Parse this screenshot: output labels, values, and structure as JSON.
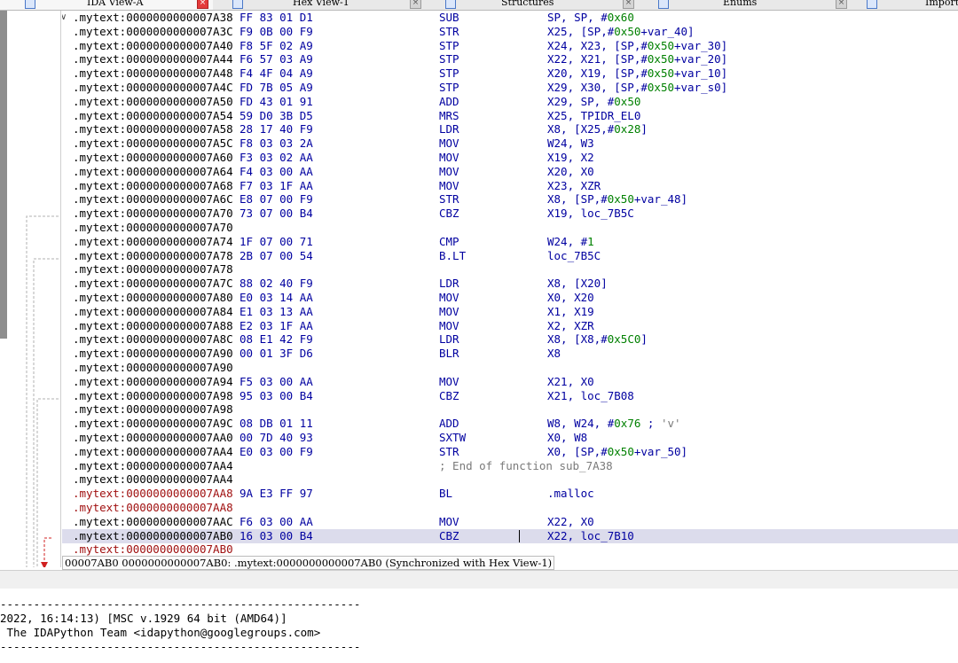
{
  "tabs": [
    {
      "label": "IDA View-A",
      "icon": "listing-icon",
      "close": "red"
    },
    {
      "label": "Hex View-1",
      "icon": "hex-icon",
      "close": "grey"
    },
    {
      "label": "Structures",
      "icon": "struct-icon",
      "close": "grey"
    },
    {
      "label": "Enums",
      "icon": "enum-icon",
      "close": "grey"
    },
    {
      "label": "Import",
      "icon": "import-icon",
      "close": ""
    }
  ],
  "listing": [
    {
      "addr": ".mytext:0000000000007A38",
      "bytes": "FF 83 01 D1",
      "mn": "SUB",
      "op": "SP, SP, #0x60",
      "fold": true
    },
    {
      "addr": ".mytext:0000000000007A3C",
      "bytes": "F9 0B 00 F9",
      "mn": "STR",
      "op": "X25, [SP,#0x50+var_40]"
    },
    {
      "addr": ".mytext:0000000000007A40",
      "bytes": "F8 5F 02 A9",
      "mn": "STP",
      "op": "X24, X23, [SP,#0x50+var_30]"
    },
    {
      "addr": ".mytext:0000000000007A44",
      "bytes": "F6 57 03 A9",
      "mn": "STP",
      "op": "X22, X21, [SP,#0x50+var_20]"
    },
    {
      "addr": ".mytext:0000000000007A48",
      "bytes": "F4 4F 04 A9",
      "mn": "STP",
      "op": "X20, X19, [SP,#0x50+var_10]"
    },
    {
      "addr": ".mytext:0000000000007A4C",
      "bytes": "FD 7B 05 A9",
      "mn": "STP",
      "op": "X29, X30, [SP,#0x50+var_s0]"
    },
    {
      "addr": ".mytext:0000000000007A50",
      "bytes": "FD 43 01 91",
      "mn": "ADD",
      "op": "X29, SP, #0x50"
    },
    {
      "addr": ".mytext:0000000000007A54",
      "bytes": "59 D0 3B D5",
      "mn": "MRS",
      "op": "X25, TPIDR_EL0"
    },
    {
      "addr": ".mytext:0000000000007A58",
      "bytes": "28 17 40 F9",
      "mn": "LDR",
      "op": "X8, [X25,#0x28]"
    },
    {
      "addr": ".mytext:0000000000007A5C",
      "bytes": "F8 03 03 2A",
      "mn": "MOV",
      "op": "W24, W3"
    },
    {
      "addr": ".mytext:0000000000007A60",
      "bytes": "F3 03 02 AA",
      "mn": "MOV",
      "op": "X19, X2"
    },
    {
      "addr": ".mytext:0000000000007A64",
      "bytes": "F4 03 00 AA",
      "mn": "MOV",
      "op": "X20, X0"
    },
    {
      "addr": ".mytext:0000000000007A68",
      "bytes": "F7 03 1F AA",
      "mn": "MOV",
      "op": "X23, XZR"
    },
    {
      "addr": ".mytext:0000000000007A6C",
      "bytes": "E8 07 00 F9",
      "mn": "STR",
      "op": "X8, [SP,#0x50+var_48]"
    },
    {
      "addr": ".mytext:0000000000007A70",
      "bytes": "73 07 00 B4",
      "mn": "CBZ",
      "op": "X19, loc_7B5C"
    },
    {
      "addr": ".mytext:0000000000007A70",
      "bytes": "",
      "mn": "",
      "op": ""
    },
    {
      "addr": ".mytext:0000000000007A74",
      "bytes": "1F 07 00 71",
      "mn": "CMP",
      "op": "W24, #1"
    },
    {
      "addr": ".mytext:0000000000007A78",
      "bytes": "2B 07 00 54",
      "mn": "B.LT",
      "op": "loc_7B5C"
    },
    {
      "addr": ".mytext:0000000000007A78",
      "bytes": "",
      "mn": "",
      "op": ""
    },
    {
      "addr": ".mytext:0000000000007A7C",
      "bytes": "88 02 40 F9",
      "mn": "LDR",
      "op": "X8, [X20]"
    },
    {
      "addr": ".mytext:0000000000007A80",
      "bytes": "E0 03 14 AA",
      "mn": "MOV",
      "op": "X0, X20"
    },
    {
      "addr": ".mytext:0000000000007A84",
      "bytes": "E1 03 13 AA",
      "mn": "MOV",
      "op": "X1, X19"
    },
    {
      "addr": ".mytext:0000000000007A88",
      "bytes": "E2 03 1F AA",
      "mn": "MOV",
      "op": "X2, XZR"
    },
    {
      "addr": ".mytext:0000000000007A8C",
      "bytes": "08 E1 42 F9",
      "mn": "LDR",
      "op": "X8, [X8,#0x5C0]"
    },
    {
      "addr": ".mytext:0000000000007A90",
      "bytes": "00 01 3F D6",
      "mn": "BLR",
      "op": "X8"
    },
    {
      "addr": ".mytext:0000000000007A90",
      "bytes": "",
      "mn": "",
      "op": ""
    },
    {
      "addr": ".mytext:0000000000007A94",
      "bytes": "F5 03 00 AA",
      "mn": "MOV",
      "op": "X21, X0"
    },
    {
      "addr": ".mytext:0000000000007A98",
      "bytes": "95 03 00 B4",
      "mn": "CBZ",
      "op": "X21, loc_7B08"
    },
    {
      "addr": ".mytext:0000000000007A98",
      "bytes": "",
      "mn": "",
      "op": ""
    },
    {
      "addr": ".mytext:0000000000007A9C",
      "bytes": "08 DB 01 11",
      "mn": "ADD",
      "op": "W8, W24, #0x76 ; 'v'"
    },
    {
      "addr": ".mytext:0000000000007AA0",
      "bytes": "00 7D 40 93",
      "mn": "SXTW",
      "op": "X0, W8"
    },
    {
      "addr": ".mytext:0000000000007AA4",
      "bytes": "E0 03 00 F9",
      "mn": "STR",
      "op": "X0, [SP,#0x50+var_50]"
    },
    {
      "addr": ".mytext:0000000000007AA4",
      "bytes": "",
      "mn": "",
      "op": "",
      "comment": "; End of function sub_7A38"
    },
    {
      "addr": ".mytext:0000000000007AA4",
      "bytes": "",
      "mn": "",
      "op": ""
    },
    {
      "addr": ".mytext:0000000000007AA8",
      "bytes": "9A E3 FF 97",
      "mn": "BL",
      "op": ".malloc",
      "red": true
    },
    {
      "addr": ".mytext:0000000000007AA8",
      "bytes": "",
      "mn": "",
      "op": "",
      "red": true
    },
    {
      "addr": ".mytext:0000000000007AAC",
      "bytes": "F6 03 00 AA",
      "mn": "MOV",
      "op": "X22, X0"
    },
    {
      "addr": ".mytext:0000000000007AB0",
      "bytes": "16 03 00 B4",
      "mn": "CBZ",
      "op": "X22, loc_7B10",
      "selected": true
    },
    {
      "addr": ".mytext:0000000000007AB0",
      "bytes": "",
      "mn": "",
      "op": "",
      "red": true
    }
  ],
  "status": "00007AB0 0000000000007AB0: .mytext:0000000000007AB0 (Synchronized with Hex View-1)",
  "output": [
    "------------------------------------------------------",
    "2022, 16:14:13) [MSC v.1929 64 bit (AMD64)]",
    " The IDAPython Team <idapython@googlegroups.com>",
    "------------------------------------------------------"
  ],
  "colors": {
    "selection": "#dcdcec",
    "instruction": "#0000a0",
    "number": "#008000",
    "red_label": "#a01010"
  }
}
